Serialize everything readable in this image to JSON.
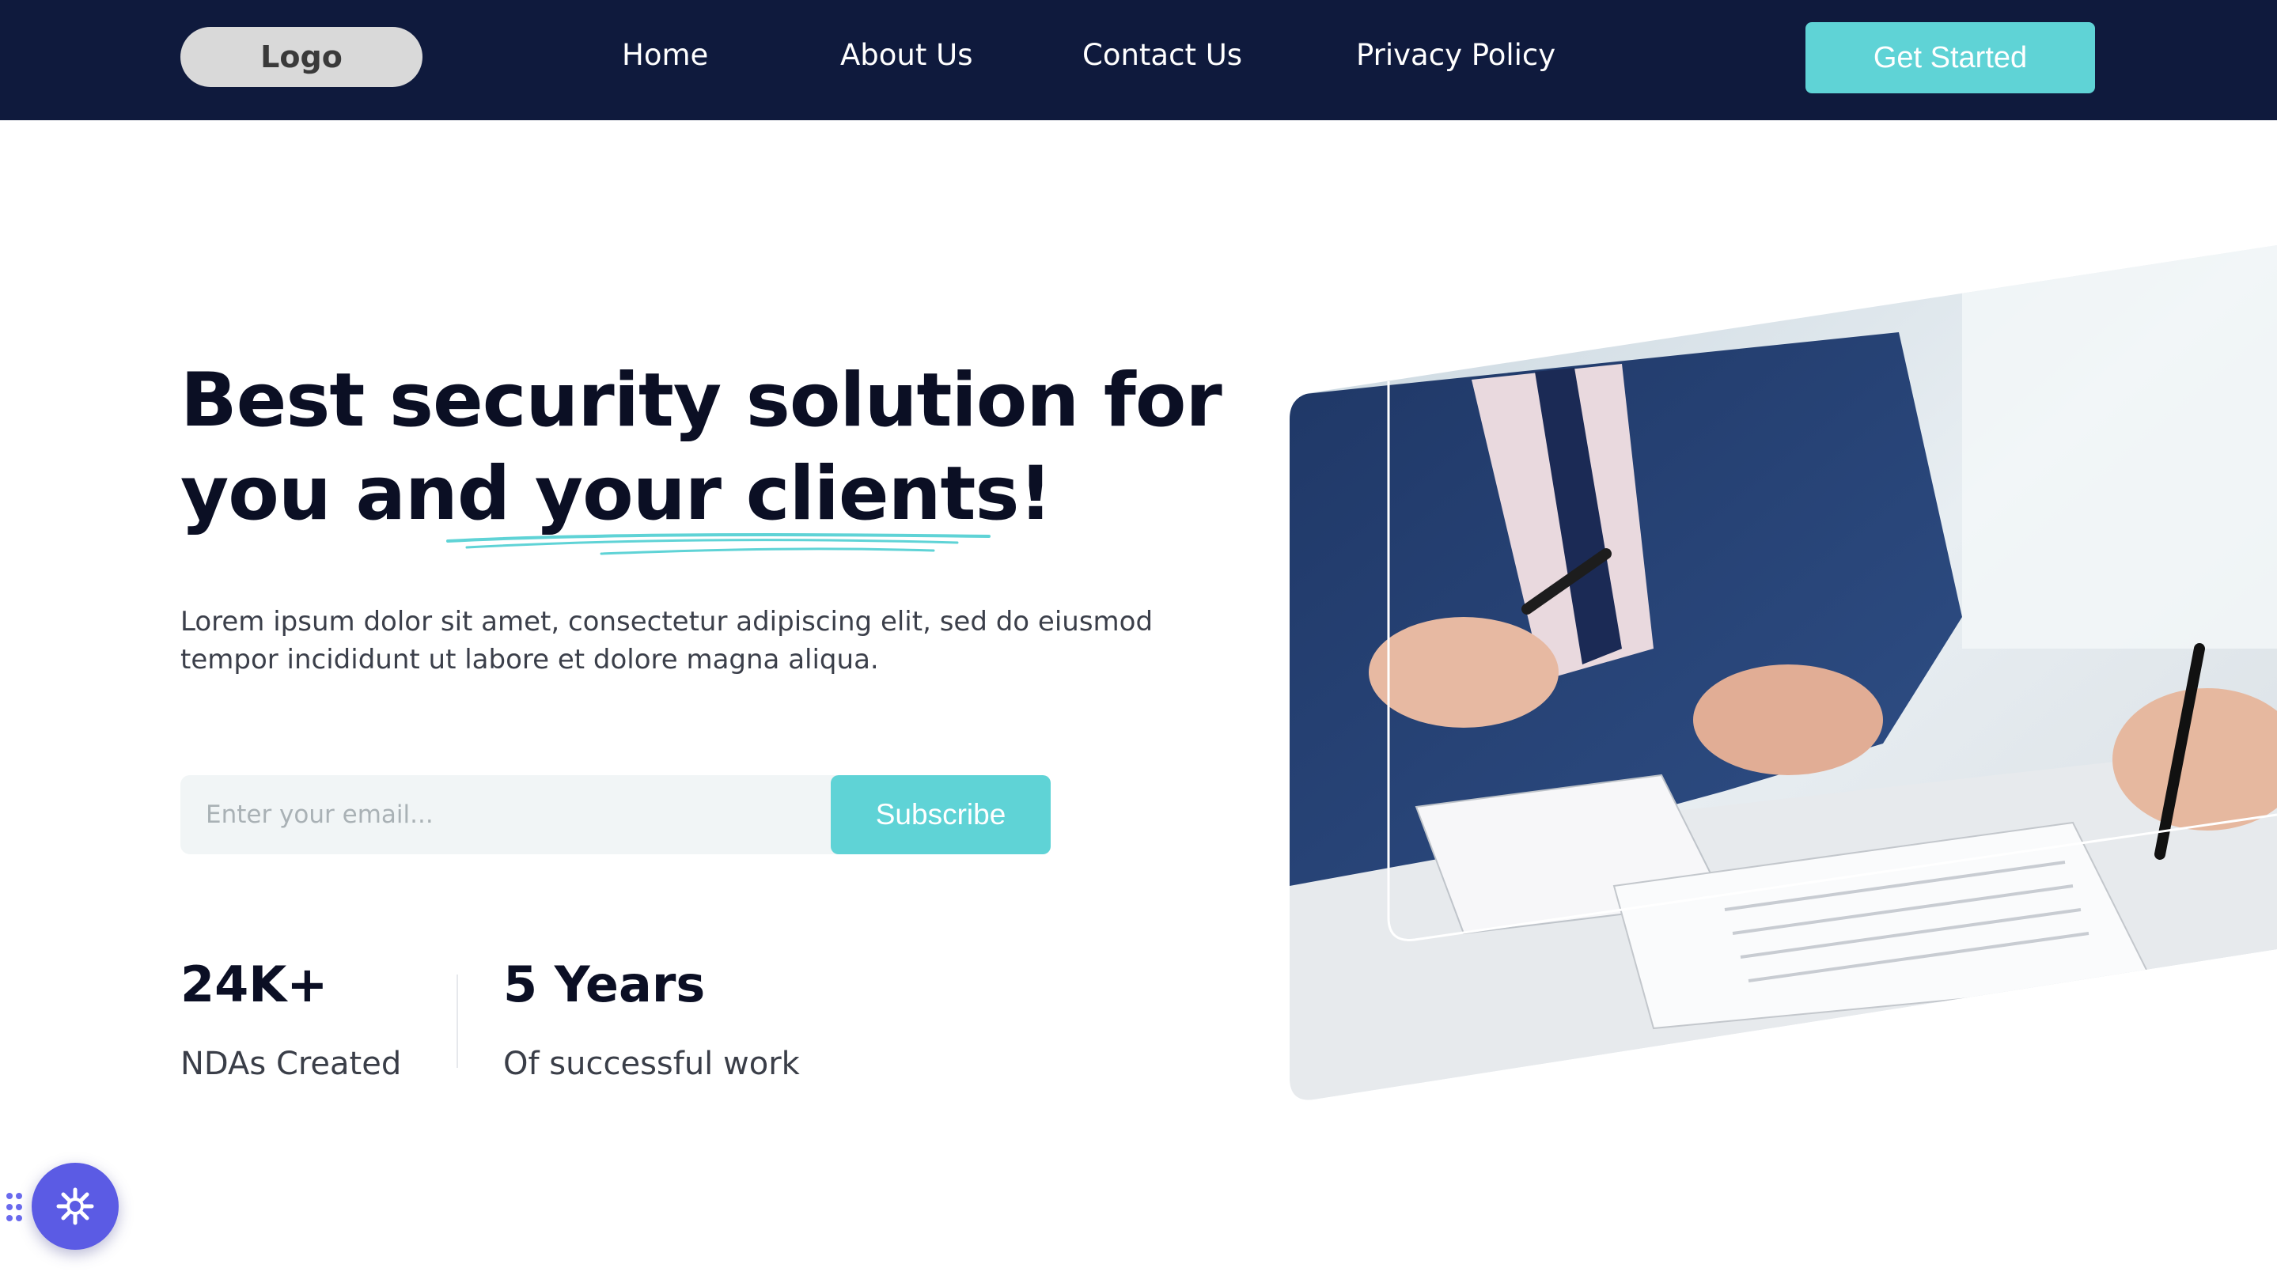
{
  "nav": {
    "logo": "Logo",
    "links": [
      "Home",
      "About Us",
      "Contact Us",
      "Privacy Policy"
    ],
    "cta": "Get Started"
  },
  "hero": {
    "headline_line1": "Best security solution for",
    "headline_line2": "you and your clients!",
    "description": "Lorem ipsum dolor sit amet, consectetur adipiscing elit, sed do eiusmod tempor incididunt ut labore et dolore magna aliqua.",
    "email_placeholder": "Enter your email...",
    "subscribe_label": "Subscribe"
  },
  "stats": [
    {
      "value": "24K+",
      "label": "NDAs Created"
    },
    {
      "value": "5 Years",
      "label": "Of successful work"
    }
  ],
  "colors": {
    "nav_bg": "#0f1a3d",
    "accent": "#5fd3d6",
    "heading": "#0b0f24",
    "widget": "#5b5be4"
  },
  "icons": {
    "widget": "gear-icon",
    "handle": "drag-handle-icon"
  }
}
